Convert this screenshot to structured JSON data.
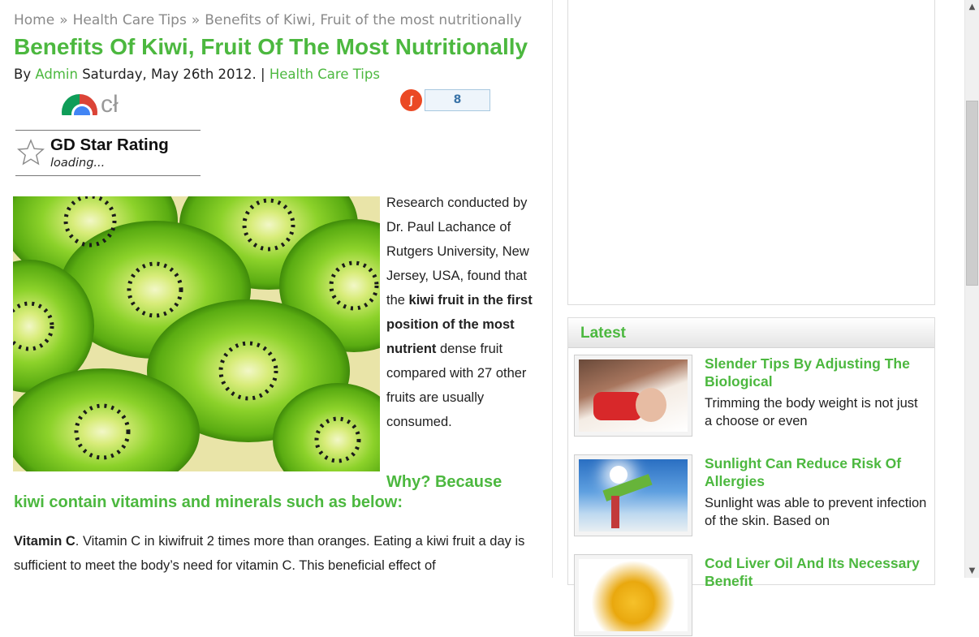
{
  "breadcrumb": {
    "items": [
      "Home",
      "Health Care Tips",
      "Benefits of Kiwi, Fruit of the most nutritionally"
    ],
    "separator": "»"
  },
  "article": {
    "title": "Benefits Of Kiwi, Fruit Of The Most Nutritionally",
    "by": "By",
    "author": "Admin",
    "date": "Saturday, May 26th 2012.",
    "pipe": "|",
    "category": "Health Care Tips",
    "share": {
      "partial_logo_text": "cł",
      "stumble_glyph": "ʃ",
      "count": "8",
      "icon": "stumbleupon-icon"
    },
    "rating": {
      "title": "GD Star Rating",
      "status": "loading...",
      "icon": "star-outline-icon"
    },
    "image_icon": "kiwi-slices-photo",
    "intro": {
      "text1": "Research conducted by Dr. Paul Lachance of Rutgers University, New Jersey, USA, found that the ",
      "bold": "kiwi fruit in the first position of the most nutrient",
      "text2": " dense fruit compared with 27 other fruits are usually consumed."
    },
    "subhead": {
      "line1": "Why? Because",
      "line2": "kiwi contain vitamins and minerals such as below:"
    },
    "vitamin_c": {
      "label": "Vitamin C",
      "text": ". Vitamin C in kiwifruit 2 times more than oranges. Eating a kiwi fruit a day is sufficient to meet the body’s need for vitamin C. This beneficial effect of"
    }
  },
  "sidebar": {
    "latest_title": "Latest",
    "posts": [
      {
        "title": "Slender Tips By Adjusting The Biological",
        "excerpt": "Trimming the body weight is not just a choose or even",
        "thumb": "woman-in-bed-photo"
      },
      {
        "title": "Sunlight Can Reduce Risk Of Allergies",
        "excerpt": "Sunlight was able to prevent infection of the skin. Based on",
        "thumb": "woman-sunlight-beach-photo"
      },
      {
        "title": "Cod Liver Oil And Its Necessary Benefit",
        "excerpt": "",
        "thumb": "fish-oil-capsules-photo"
      }
    ]
  },
  "scrollbar": {
    "up_glyph": "▲",
    "down_glyph": "▼",
    "position": 0.3
  },
  "colors": {
    "accent": "#4cb83f",
    "breadcrumb": "#8a8a8a",
    "stumble": "#eb4924",
    "count_text": "#3a74a8"
  }
}
